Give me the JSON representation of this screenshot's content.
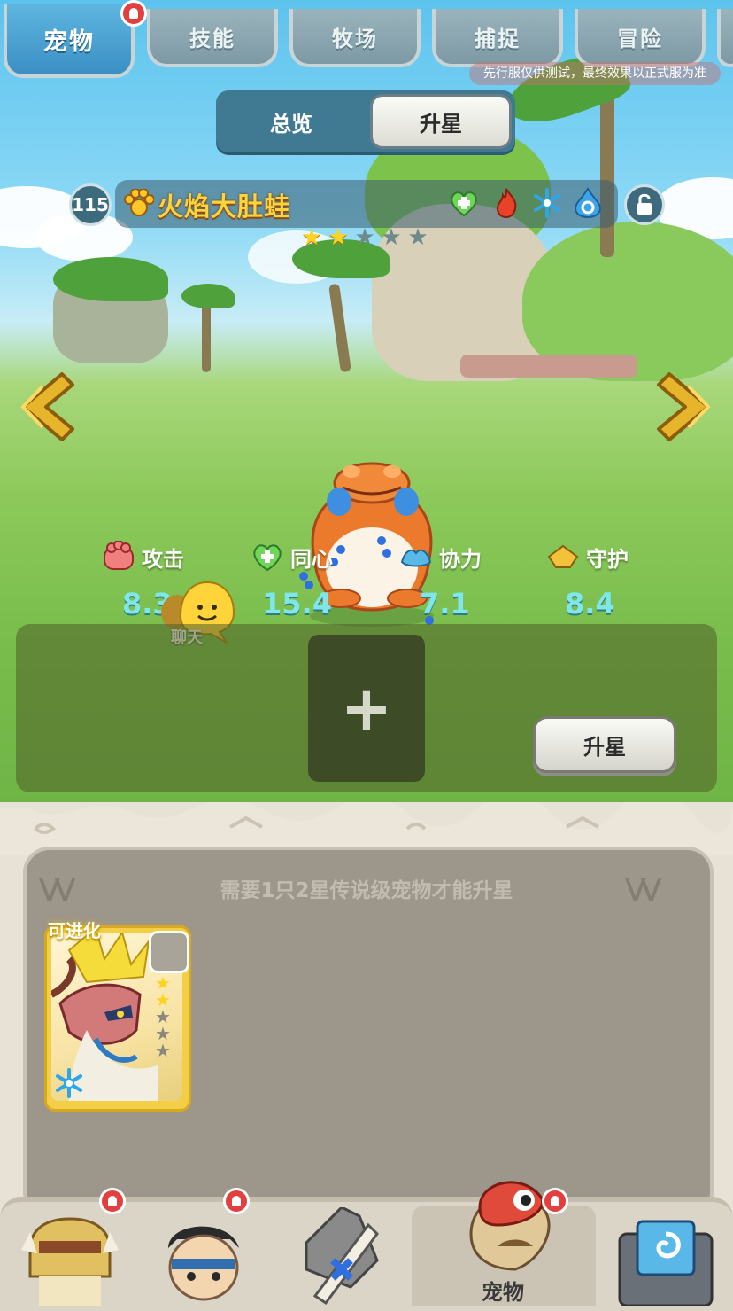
{
  "top_tabs": [
    {
      "label": "宠物",
      "active": true,
      "badge": true
    },
    {
      "label": "技能",
      "active": false
    },
    {
      "label": "牧场",
      "active": false
    },
    {
      "label": "捕捉",
      "active": false
    },
    {
      "label": "冒险",
      "active": false
    }
  ],
  "notice": "先行服仅供测试，最终效果以正式服为准",
  "toggle": {
    "overview": "总览",
    "star_up": "升星",
    "selected": "升星"
  },
  "pet": {
    "level": "115",
    "name": "火焰大肚蛙",
    "attributes": [
      "heart-icon",
      "fire-icon",
      "ice-icon",
      "water-icon"
    ],
    "stars_total": 5,
    "stars_filled": 2
  },
  "stats": [
    {
      "label": "攻击",
      "value": "8.3",
      "icon": "attack-paw-icon"
    },
    {
      "label": "同心",
      "value": "15.4",
      "icon": "heart-plus-icon"
    },
    {
      "label": "协力",
      "value": "7.1",
      "icon": "teamwork-icon"
    },
    {
      "label": "守护",
      "value": "8.4",
      "icon": "guard-icon"
    }
  ],
  "chat_label": "聊天",
  "upgrade": {
    "add_symbol": "+",
    "button": "升星"
  },
  "requirement": "需要1只2星传说级宠物才能升星",
  "card": {
    "tag": "可进化",
    "stars_total": 5,
    "stars_filled": 2,
    "element": "ice-icon"
  },
  "nav": {
    "active_label": "宠物",
    "badges": [
      true,
      true,
      false,
      true,
      false
    ]
  },
  "colors": {
    "name_yellow": "#ffd43a",
    "stat_cyan": "#7fe7ea",
    "tab_active": "#3b8fc4",
    "badge_red": "#e33f3f"
  }
}
